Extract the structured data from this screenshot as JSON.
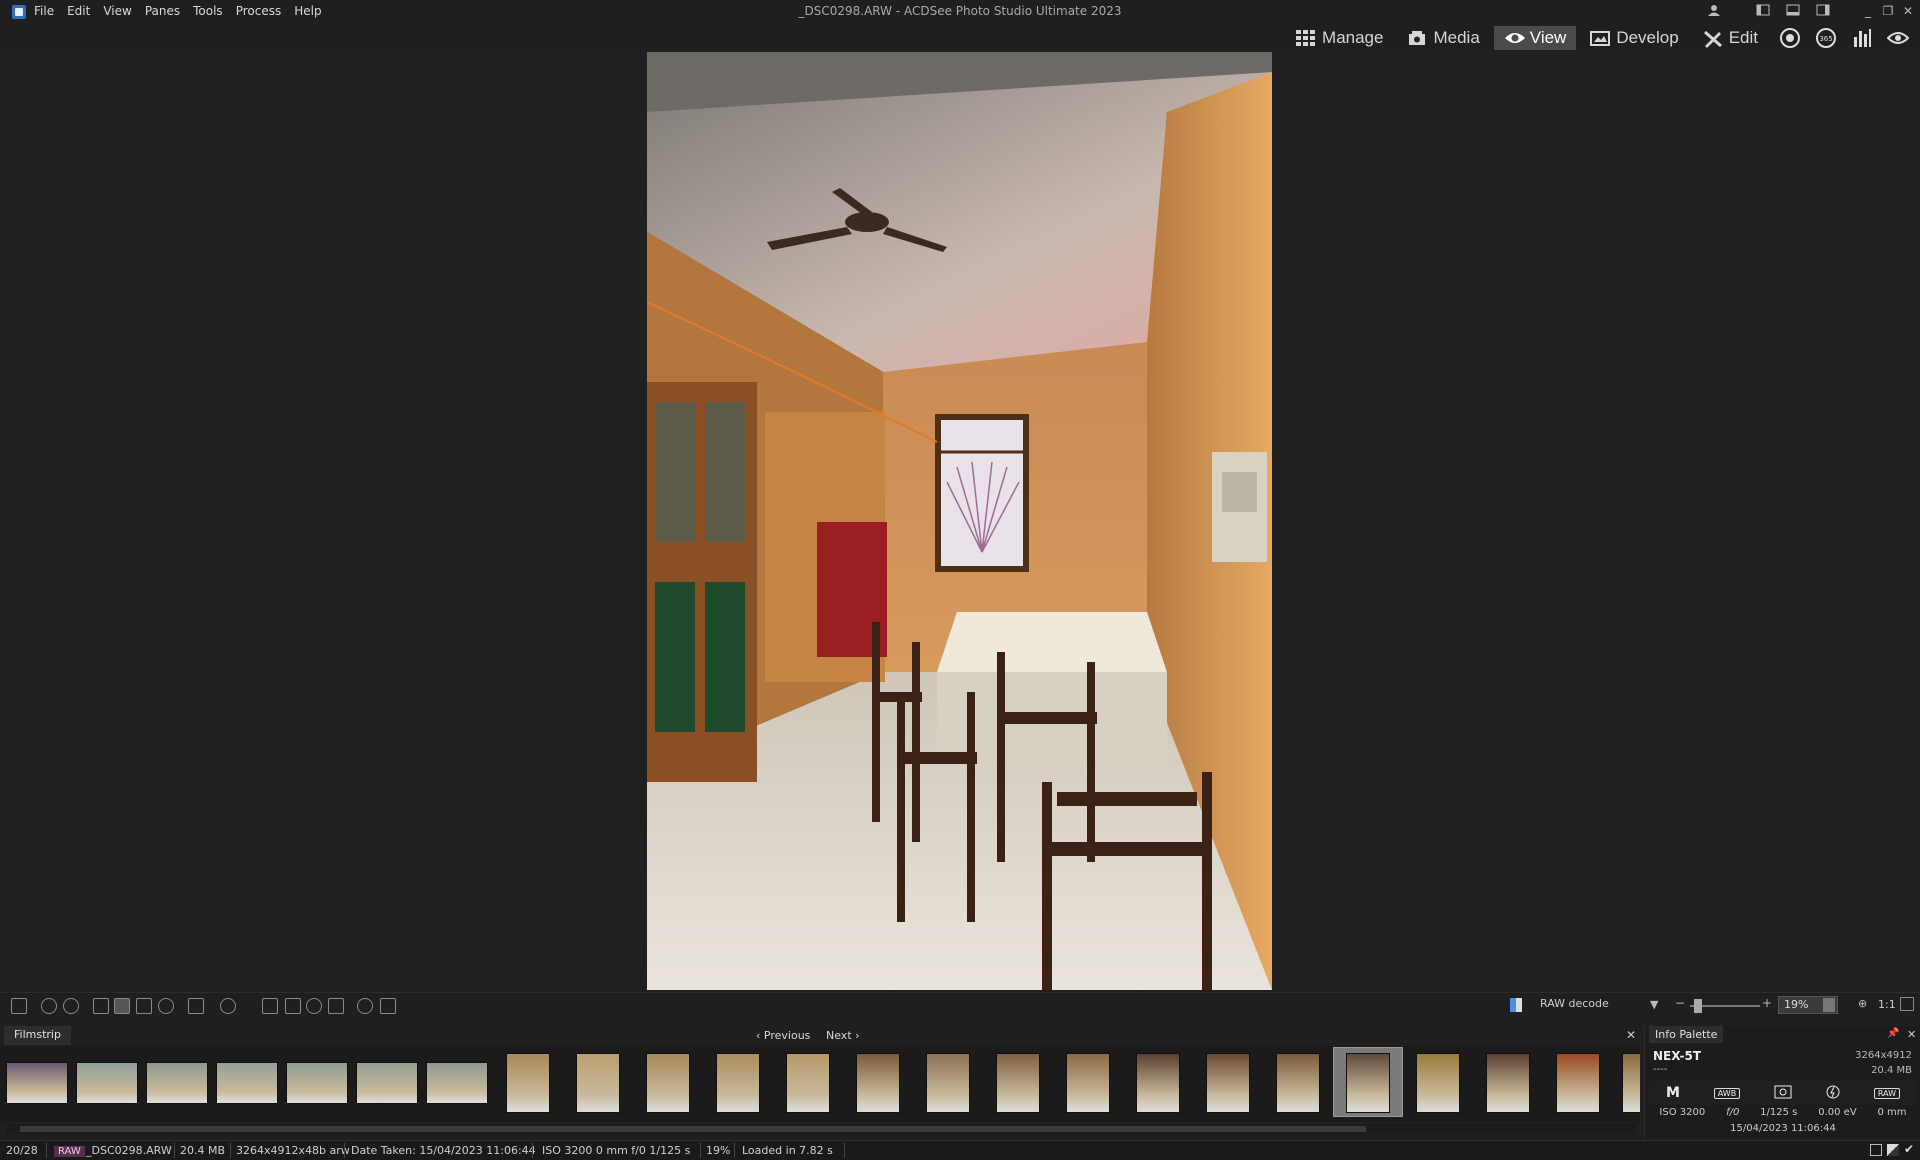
{
  "window": {
    "title": "_DSC0298.ARW - ACDSee Photo Studio Ultimate 2023",
    "controls": [
      "minimize",
      "restore",
      "close"
    ]
  },
  "menu": [
    "File",
    "Edit",
    "View",
    "Panes",
    "Tools",
    "Process",
    "Help"
  ],
  "modes": [
    {
      "label": "Manage",
      "icon": "grid-icon",
      "active": false
    },
    {
      "label": "Media",
      "icon": "media-icon",
      "active": false
    },
    {
      "label": "View",
      "icon": "eye-icon",
      "active": true
    },
    {
      "label": "Develop",
      "icon": "develop-icon",
      "active": false
    },
    {
      "label": "Edit",
      "icon": "edit-icon",
      "active": false
    }
  ],
  "mode_icons": [
    "dashboard-icon",
    "365-icon",
    "histogram-icon",
    "eye-toggle-icon"
  ],
  "viewer_toolbar": {
    "decode_label": "RAW decode",
    "zoom_value": "19%",
    "zoom_ratio": "1:1"
  },
  "filmstrip": {
    "title": "Filmstrip",
    "previous_label": "Previous",
    "next_label": "Next",
    "selected_index": 19,
    "count": 24
  },
  "info_palette": {
    "title": "Info Palette",
    "camera": "NEX-5T",
    "dimensions": "3264x4912",
    "dashes": "----",
    "file_size": "20.4 MB",
    "mode": "M",
    "wb": "AWB",
    "raw": "RAW",
    "iso": "ISO 3200",
    "aperture": "f/0",
    "shutter": "1/125 s",
    "exposure": "0.00 eV",
    "focal": "0 mm",
    "date": "15/04/2023 11:06:44"
  },
  "statusbar": {
    "position": "20/28",
    "raw_badge": "RAW",
    "filename": "_DSC0298.ARW",
    "file_size": "20.4 MB",
    "dimensions": "3264x4912x48b arw",
    "date_taken": "Date Taken: 15/04/2023 11:06:44",
    "exif": "ISO 3200   0 mm   f/0   1/125 s",
    "zoom": "19%",
    "load_time": "Loaded in 7.82 s"
  }
}
